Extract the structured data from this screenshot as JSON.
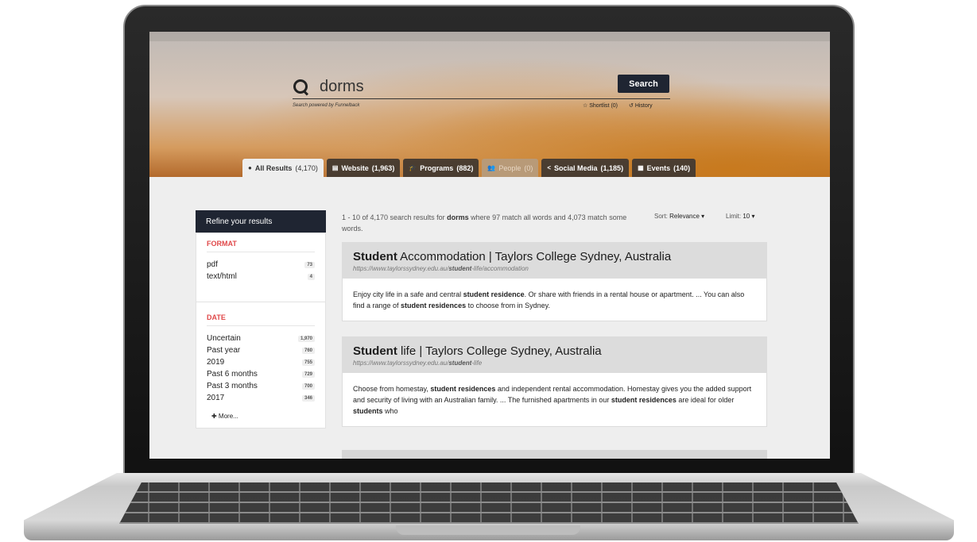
{
  "search": {
    "query": "dorms",
    "button_label": "Search",
    "powered_by": "Search powered by Funnelback",
    "shortlist": "☆ Shortlist (0)",
    "history": "↺ History"
  },
  "tabs": [
    {
      "icon": "●",
      "name": "All Results",
      "count": "(4,170)"
    },
    {
      "icon": "▤",
      "name": "Website",
      "count": "(1,963)"
    },
    {
      "icon": "🎓",
      "name": "Programs",
      "count": "(882)"
    },
    {
      "icon": "👥",
      "name": "People",
      "count": "(0)"
    },
    {
      "icon": "<",
      "name": "Social Media",
      "count": "(1,185)"
    },
    {
      "icon": "▦",
      "name": "Events",
      "count": "(140)"
    }
  ],
  "sidebar": {
    "header": "Refine your results",
    "format": {
      "title": "FORMAT",
      "items": [
        {
          "label": "pdf",
          "count": "73"
        },
        {
          "label": "text/html",
          "count": "4"
        }
      ]
    },
    "date": {
      "title": "DATE",
      "items": [
        {
          "label": "Uncertain",
          "count": "1,970"
        },
        {
          "label": "Past year",
          "count": "760"
        },
        {
          "label": "2019",
          "count": "755"
        },
        {
          "label": "Past 6 months",
          "count": "729"
        },
        {
          "label": "Past 3 months",
          "count": "700"
        },
        {
          "label": "2017",
          "count": "346"
        }
      ],
      "more": "✚ More..."
    }
  },
  "summary": {
    "p1": "1 - 10 of 4,170 search results for ",
    "query": "dorms",
    "p2": " where 97 match all words and 4,073 match some words."
  },
  "sort": {
    "label": "Sort:",
    "value": "Relevance ▾"
  },
  "limit": {
    "label": "Limit:",
    "value": "10 ▾"
  },
  "results": [
    {
      "title_bold": "Student",
      "title_rest": " Accommodation | Taylors College Sydney, Australia",
      "url_pre": "https://www.taylorssydney.edu.au/",
      "url_bold": "student",
      "url_post": "-life/accommodation",
      "snippet": [
        {
          "t": "Enjoy city life in a safe and central ",
          "b": false
        },
        {
          "t": "student residence",
          "b": true
        },
        {
          "t": ". Or share with friends in a rental house or apartment. ... You can also find a range of ",
          "b": false
        },
        {
          "t": "student residences",
          "b": true
        },
        {
          "t": " to choose from in Sydney.",
          "b": false
        }
      ]
    },
    {
      "title_bold": "Student",
      "title_rest": " life | Taylors College Sydney, Australia",
      "url_pre": "https://www.taylorssydney.edu.au/",
      "url_bold": "student",
      "url_post": "-life",
      "snippet": [
        {
          "t": "Choose from homestay, ",
          "b": false
        },
        {
          "t": "student residences",
          "b": true
        },
        {
          "t": " and independent rental accommodation. Homestay gives you the added support and security of living with an Australian family. ... The furnished apartments in our ",
          "b": false
        },
        {
          "t": "student residences",
          "b": true
        },
        {
          "t": " are ideal for older ",
          "b": false
        },
        {
          "t": "students",
          "b": true
        },
        {
          "t": " who",
          "b": false
        }
      ]
    }
  ]
}
